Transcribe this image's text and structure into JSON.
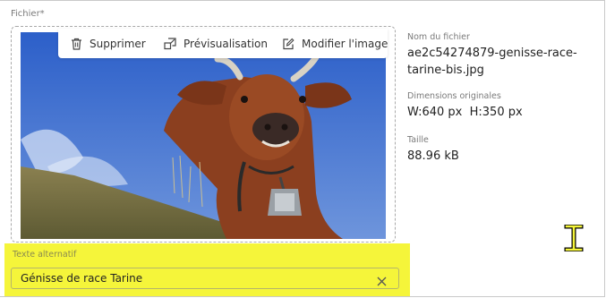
{
  "file_field": {
    "label": "Fichier*"
  },
  "toolbar": {
    "delete_label": "Supprimer",
    "preview_label": "Prévisualisation",
    "edit_label": "Modifier l'image"
  },
  "file_info": {
    "name_label": "Nom du fichier",
    "name_value": "ae2c54274879-genisse-race-tarine-bis.jpg",
    "dimensions_label": "Dimensions originales",
    "dimensions_value": "W:640 px  H:350 px",
    "size_label": "Taille",
    "size_value": "88.96 kB"
  },
  "alt_text": {
    "label": "Texte alternatif",
    "value": "Génisse de race Tarine"
  },
  "icons": {
    "delete": "trash-icon",
    "preview": "preview-icon",
    "edit": "edit-icon",
    "clear": "close-icon",
    "cursor": "text-cursor-icon"
  },
  "colors": {
    "highlight": "#f5f53a"
  }
}
